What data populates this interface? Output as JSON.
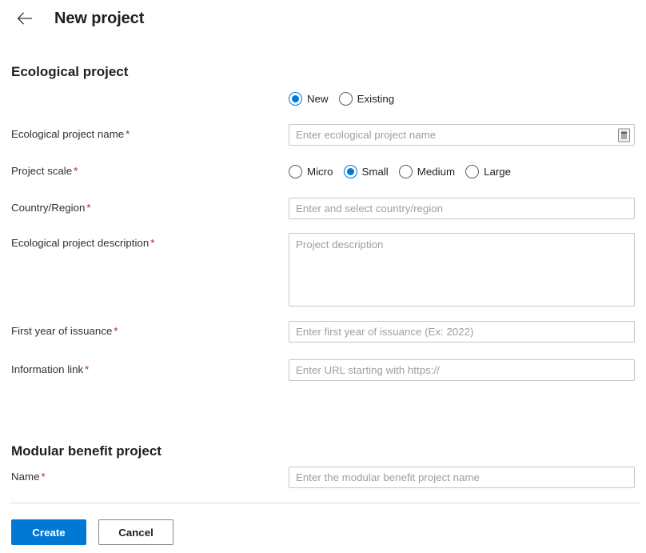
{
  "header": {
    "back_icon": "arrow-left-icon",
    "title": "New project"
  },
  "sections": [
    {
      "heading": "Ecological project",
      "project_type": {
        "options": [
          {
            "label": "New",
            "checked": true
          },
          {
            "label": "Existing",
            "checked": false
          }
        ]
      },
      "fields": {
        "project_name": {
          "label": "Ecological project name",
          "required": "*",
          "value": "",
          "placeholder": "Enter ecological project name",
          "trailing_icon": "ime-mode-icon"
        },
        "project_scale": {
          "label": "Project scale",
          "required": "*",
          "options": [
            {
              "label": "Micro",
              "checked": false
            },
            {
              "label": "Small",
              "checked": true
            },
            {
              "label": "Medium",
              "checked": false
            },
            {
              "label": "Large",
              "checked": false
            }
          ]
        },
        "country_region": {
          "label": "Country/Region",
          "required": "*",
          "value": "",
          "placeholder": "Enter and select country/region"
        },
        "description": {
          "label": "Ecological project description",
          "required": "*",
          "value": "",
          "placeholder": "Project description"
        },
        "first_year": {
          "label": "First year of issuance",
          "required": "*",
          "value": "",
          "placeholder": "Enter first year of issuance (Ex: 2022)"
        },
        "information_link": {
          "label": "Information link",
          "required": "*",
          "value": "",
          "placeholder": "Enter URL starting with https://"
        }
      }
    },
    {
      "heading": "Modular benefit project",
      "fields": {
        "name": {
          "label": "Name",
          "required": "*",
          "value": "",
          "placeholder": "Enter the modular benefit project name"
        }
      }
    }
  ],
  "footer": {
    "create_label": "Create",
    "cancel_label": "Cancel"
  },
  "colors": {
    "accent": "#0078d4",
    "required_asterisk": "#a4262c",
    "border": "#c8c6c4",
    "divider": "#e1dfdd",
    "placeholder": "#a19f9d"
  }
}
